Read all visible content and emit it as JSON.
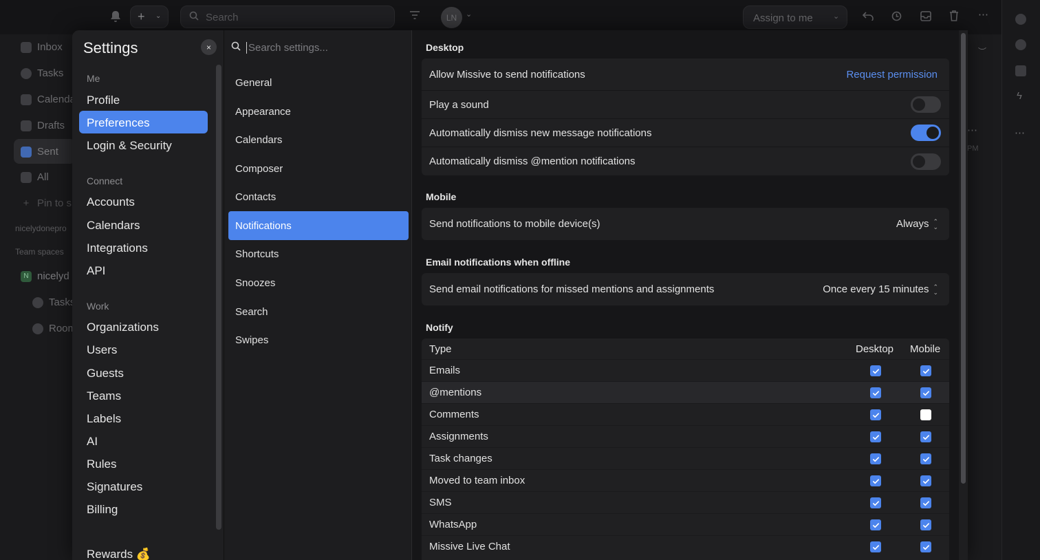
{
  "background": {
    "search_placeholder": "Search",
    "assign_label": "Assign to me",
    "avatar_initials": "LN",
    "sidebar": [
      "Inbox",
      "Tasks",
      "Calenda",
      "Drafts",
      "Sent",
      "All",
      "Pin to s"
    ],
    "org_label": "nicelydonepro",
    "team_spaces": "Team spaces",
    "team_name": "nicelyd",
    "team_badge": "N",
    "team_items": [
      "Tasks",
      "Room"
    ],
    "partial_time": "PM"
  },
  "settings": {
    "title": "Settings",
    "close_icon": "×",
    "sections": [
      {
        "label": "Me",
        "items": [
          "Profile",
          "Preferences",
          "Login & Security"
        ]
      },
      {
        "label": "Connect",
        "items": [
          "Accounts",
          "Calendars",
          "Integrations",
          "API"
        ]
      },
      {
        "label": "Work",
        "items": [
          "Organizations",
          "Users",
          "Guests",
          "Teams",
          "Labels",
          "AI",
          "Rules",
          "Signatures",
          "Billing"
        ]
      }
    ],
    "rewards": "Rewards 💰",
    "selected": "Preferences"
  },
  "submenu": {
    "search_placeholder": "Search settings...",
    "items": [
      "General",
      "Appearance",
      "Calendars",
      "Composer",
      "Contacts",
      "Notifications",
      "Shortcuts",
      "Snoozes",
      "Search",
      "Swipes"
    ],
    "selected": "Notifications"
  },
  "content": {
    "desktop": {
      "heading": "Desktop",
      "allow_label": "Allow Missive to send notifications",
      "allow_action": "Request permission",
      "toggles": [
        {
          "label": "Play a sound",
          "on": false
        },
        {
          "label": "Automatically dismiss new message notifications",
          "on": true
        },
        {
          "label": "Automatically dismiss @mention notifications",
          "on": false
        }
      ]
    },
    "mobile": {
      "heading": "Mobile",
      "label": "Send notifications to mobile device(s)",
      "value": "Always"
    },
    "email": {
      "heading": "Email notifications when offline",
      "label": "Send email notifications for missed mentions and assignments",
      "value": "Once every 15 minutes"
    },
    "notify": {
      "heading": "Notify",
      "columns": [
        "Type",
        "Desktop",
        "Mobile"
      ],
      "rows": [
        {
          "type": "Emails",
          "desktop": true,
          "mobile": true
        },
        {
          "type": "@mentions",
          "desktop": true,
          "mobile": true
        },
        {
          "type": "Comments",
          "desktop": true,
          "mobile": false
        },
        {
          "type": "Assignments",
          "desktop": true,
          "mobile": true
        },
        {
          "type": "Task changes",
          "desktop": true,
          "mobile": true
        },
        {
          "type": "Moved to team inbox",
          "desktop": true,
          "mobile": true
        },
        {
          "type": "SMS",
          "desktop": true,
          "mobile": true
        },
        {
          "type": "WhatsApp",
          "desktop": true,
          "mobile": true
        },
        {
          "type": "Missive Live Chat",
          "desktop": true,
          "mobile": true
        }
      ]
    }
  },
  "colors": {
    "accent": "#4c84ec",
    "link": "#5b8ff0",
    "background": "#1b1b1d"
  }
}
